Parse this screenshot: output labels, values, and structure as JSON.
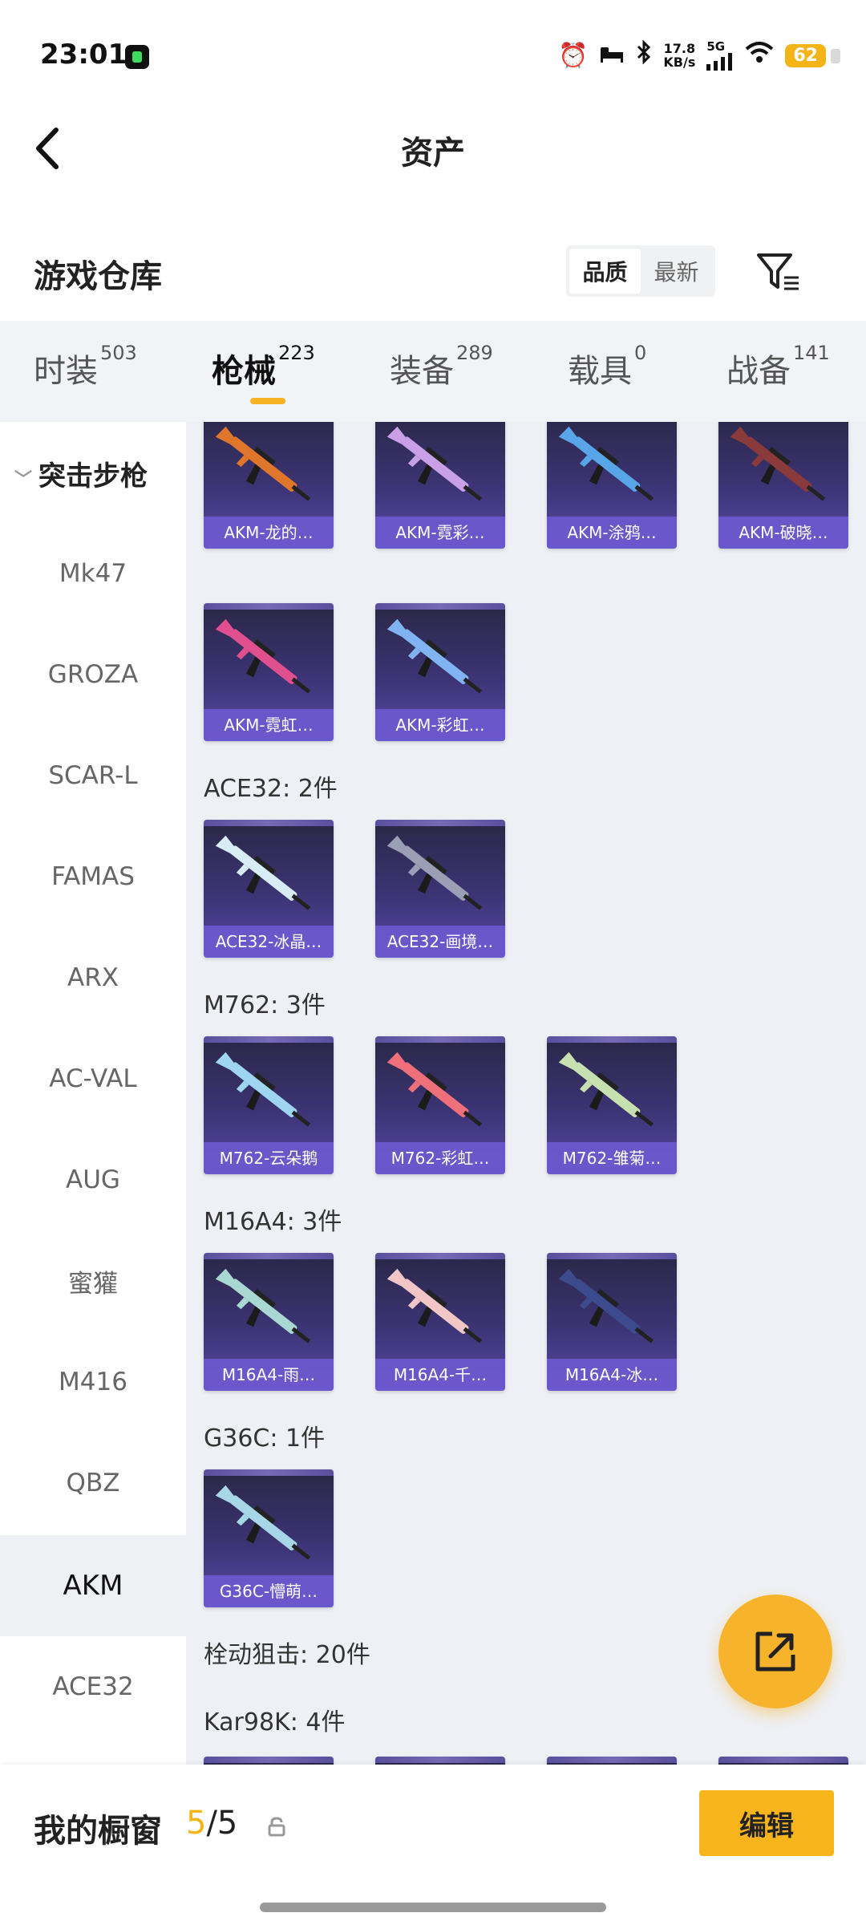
{
  "status_bar": {
    "time": "23:01",
    "net_speed_value": "17.8",
    "net_speed_unit": "KB/s",
    "network": "5G",
    "battery": "62"
  },
  "header": {
    "title": "资产"
  },
  "warehouse": {
    "title": "游戏仓库",
    "sort_options": [
      "品质",
      "最新"
    ],
    "active_sort": "品质"
  },
  "categories": [
    {
      "label": "时装",
      "count": "503"
    },
    {
      "label": "枪械",
      "count": "223"
    },
    {
      "label": "装备",
      "count": "289"
    },
    {
      "label": "载具",
      "count": "0"
    },
    {
      "label": "战备",
      "count": "141"
    }
  ],
  "active_category": "枪械",
  "sidebar": {
    "group": "突击步枪",
    "items": [
      "Mk47",
      "GROZA",
      "SCAR-L",
      "FAMAS",
      "ARX",
      "AC-VAL",
      "AUG",
      "蜜獾",
      "M416",
      "QBZ",
      "AKM",
      "ACE32"
    ],
    "active": "AKM"
  },
  "akm_cards": [
    "AKM-龙的…",
    "AKM-霓彩…",
    "AKM-涂鸦…",
    "AKM-破晓…",
    "AKM-霓虹…",
    "AKM-彩虹…"
  ],
  "groups": [
    {
      "label": "ACE32: 2件",
      "cards": [
        "ACE32-冰晶…",
        "ACE32-画境…"
      ]
    },
    {
      "label": "M762: 3件",
      "cards": [
        "M762-云朵鹅",
        "M762-彩虹…",
        "M762-雏菊…"
      ]
    },
    {
      "label": "M16A4: 3件",
      "cards": [
        "M16A4-雨…",
        "M16A4-千…",
        "M16A4-冰…"
      ]
    },
    {
      "label": "G36C: 1件",
      "cards": [
        "G36C-懵萌…"
      ]
    }
  ],
  "bolt_action_label": "栓动狙击: 20件",
  "kar98k_label": "Kar98K: 4件",
  "gun_colors": [
    "#e0762c",
    "#c9a0e8",
    "#58a6e8",
    "#8a3a3a",
    "#e04f8e",
    "#7fb3f2",
    "#d8ecf5",
    "#9b9fb5",
    "#9ed6f2",
    "#ef6f7a",
    "#c7e0b0",
    "#a9d8d2",
    "#f2c6c6",
    "#3c4a8e",
    "#a7d6e6"
  ],
  "bottom_bar": {
    "shelf_label": "我的橱窗",
    "shelf_current": "5",
    "shelf_total": "/5",
    "edit_label": "编辑"
  },
  "accent_color": "#f7b41b"
}
